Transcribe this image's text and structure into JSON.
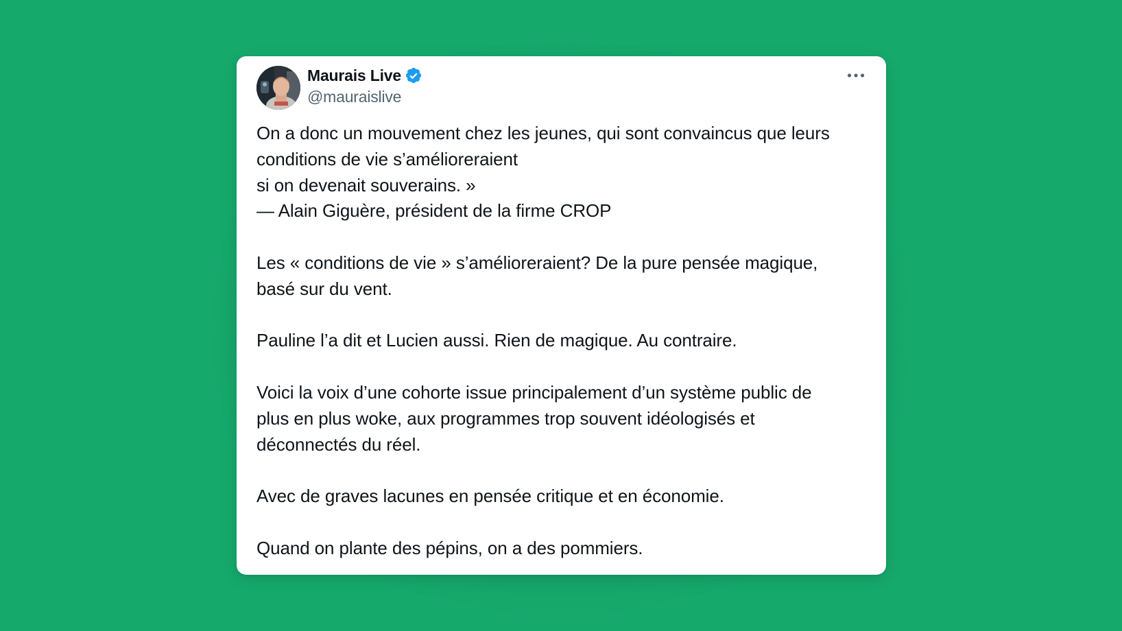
{
  "background_color": "#16a96c",
  "accent_color": "#1d9bf0",
  "tweet": {
    "author": {
      "display_name": "Maurais Live",
      "handle": "@mauraislive",
      "verified": true,
      "avatar_icon": "profile-photo"
    },
    "more_icon": "more-horizontal-icon",
    "paragraphs": [
      {
        "lines": [
          "On a donc un mouvement chez les jeunes, qui sont convaincus que leurs",
          "conditions de vie s’amélioreraient",
          "si on devenait souverains. »",
          "— Alain Giguère, président de la firme CROP"
        ]
      },
      {
        "lines": [
          "Les « conditions de vie » s’amélioreraient? De la pure pensée magique,",
          "basé sur du vent."
        ]
      },
      {
        "lines": [
          "Pauline l’a dit et Lucien aussi. Rien de magique. Au contraire."
        ]
      },
      {
        "lines": [
          "Voici la voix d’une cohorte issue principalement d’un système public de",
          "plus en plus woke, aux programmes trop souvent idéologisés et",
          "déconnectés du réel."
        ]
      },
      {
        "lines": [
          "Avec de graves lacunes en pensée critique et en économie."
        ]
      },
      {
        "lines": [
          "Quand on plante des pépins, on a des pommiers."
        ]
      }
    ]
  }
}
